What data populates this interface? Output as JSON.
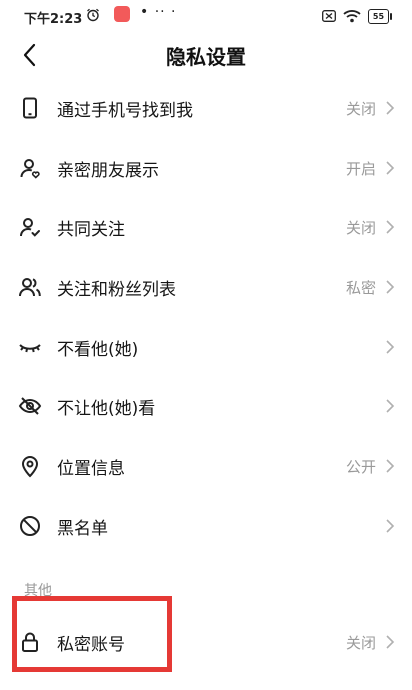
{
  "status_bar": {
    "time": "下午2:23",
    "dots": "• ·· ·",
    "battery": "55"
  },
  "header": {
    "title": "隐私设置"
  },
  "rows": [
    {
      "icon": "phone-icon",
      "label": "通过手机号找到我",
      "value": "关闭"
    },
    {
      "icon": "close-friend-icon",
      "label": "亲密朋友展示",
      "value": "开启"
    },
    {
      "icon": "user-check-icon",
      "label": "共同关注",
      "value": "关闭"
    },
    {
      "icon": "users-icon",
      "label": "关注和粉丝列表",
      "value": "私密"
    },
    {
      "icon": "closed-eye-icon",
      "label": "不看他(她)",
      "value": ""
    },
    {
      "icon": "eye-off-icon",
      "label": "不让他(她)看",
      "value": ""
    },
    {
      "icon": "location-icon",
      "label": "位置信息",
      "value": "公开"
    },
    {
      "icon": "block-icon",
      "label": "黑名单",
      "value": ""
    }
  ],
  "section_other": "其他",
  "private_account": {
    "label": "私密账号",
    "value": "关闭"
  },
  "colors": {
    "highlight": "#e53935",
    "muted": "#9a9a9a"
  }
}
